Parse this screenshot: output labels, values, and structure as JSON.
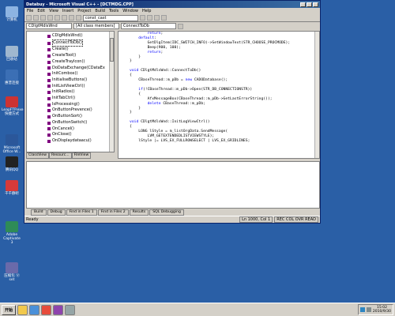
{
  "desktop": {
    "icons": [
      {
        "label": "计算机",
        "color": "#8db4e2"
      },
      {
        "label": "回收站",
        "color": "#9fb7cf"
      },
      {
        "label": "惠普连接",
        "color": "#3b6fb5"
      },
      {
        "label": "LeapFTP.exe 快捷方式",
        "color": "#cc3333"
      },
      {
        "label": "Microsoft Office W...",
        "color": "#2b579a"
      },
      {
        "label": "腾讯QQ",
        "color": "#222222"
      },
      {
        "label": "千千静听",
        "color": "#d63a3a"
      },
      {
        "label": "Adobe Captivate 3",
        "color": "#2e8b57"
      },
      {
        "label": "压缩包 Ⓥ set",
        "color": "#6a6aaa"
      }
    ]
  },
  "window": {
    "title": "Databuy - Microsoft Visual C++ - [DCTMDG.CPP]",
    "menu": [
      "File",
      "Edit",
      "View",
      "Insert",
      "Project",
      "Build",
      "Tools",
      "Window",
      "Help"
    ],
    "class_combo": "CDlgtMdlsWnd",
    "members_combo": "[All class members]",
    "function_combo": "ConnectToDb",
    "find_combo": "const_cast",
    "class_tree": [
      "CDlgMdlsWnd()",
      "ConnectToDb()",
      "Create()",
      "CreateTool()",
      "CreateTrayIcon()",
      "DoDataExchange(CDataEx",
      "InitCombox()",
      "InitialiseButtons()",
      "InitListViewCtrl()",
      "InitRadios()",
      "InitTabCtrl()",
      "IsProcessing()",
      "OnButtonPrevence()",
      "OnButtonSort()",
      "OnButtonSwitch()",
      "OnCancel()",
      "OnClose()",
      "OnDisplaydataacu()"
    ],
    "panel_tabs": [
      "ClassView",
      "Resourc...",
      "FileView"
    ],
    "code_lines": [
      "        return;",
      "    default:",
      "        GetDlgItem(IDC_SWITCH_INFO)->SetWindowText(STR_CHOOSE_PROCMODE);",
      "        Beep(900, 100);",
      "        return;",
      "    }",
      "}",
      "",
      "void CDlgtMdlsWnd::ConnectToDb()",
      "{",
      "    CBaseThread::m_pDb = new CADODatabase();",
      "",
      "    if(!CBaseThread::m_pDb->Open(STR_DB_CONNECTIONSTR))",
      "    {",
      "        AfxMessageBox(CBaseThread::m_pDb->GetLastErrorString());",
      "        delete CBaseThread::m_pDb;",
      "    }",
      "}",
      "",
      "void CDlgtMdlsWnd::InitLogViewCtrl()",
      "{",
      "    LONG lStyle = m_listOrgData.SendMessage(",
      "        LVM_GETEXTENDEDLISTVIEWSTYLE);",
      "    lStyle |= LVS_EX_FULLROWSELECT | LVS_EX_GRIDLINES;"
    ],
    "output_tabs": [
      "Build",
      "Debug",
      "Find in Files 1",
      "Find in Files 2",
      "Results",
      "SQL Debugging"
    ],
    "status": {
      "left": "Ready",
      "position": "Ln 1000, Col 1",
      "indicators": [
        "REC",
        "COL",
        "OVR",
        "READ"
      ]
    }
  },
  "taskbar": {
    "start_label": "开始",
    "clock_time": "15:02",
    "clock_date": "2010/9/30"
  },
  "colors": {
    "desktop": "#2a5fa6",
    "titlebar": "#0a246a",
    "keyword": "#0000ff"
  }
}
